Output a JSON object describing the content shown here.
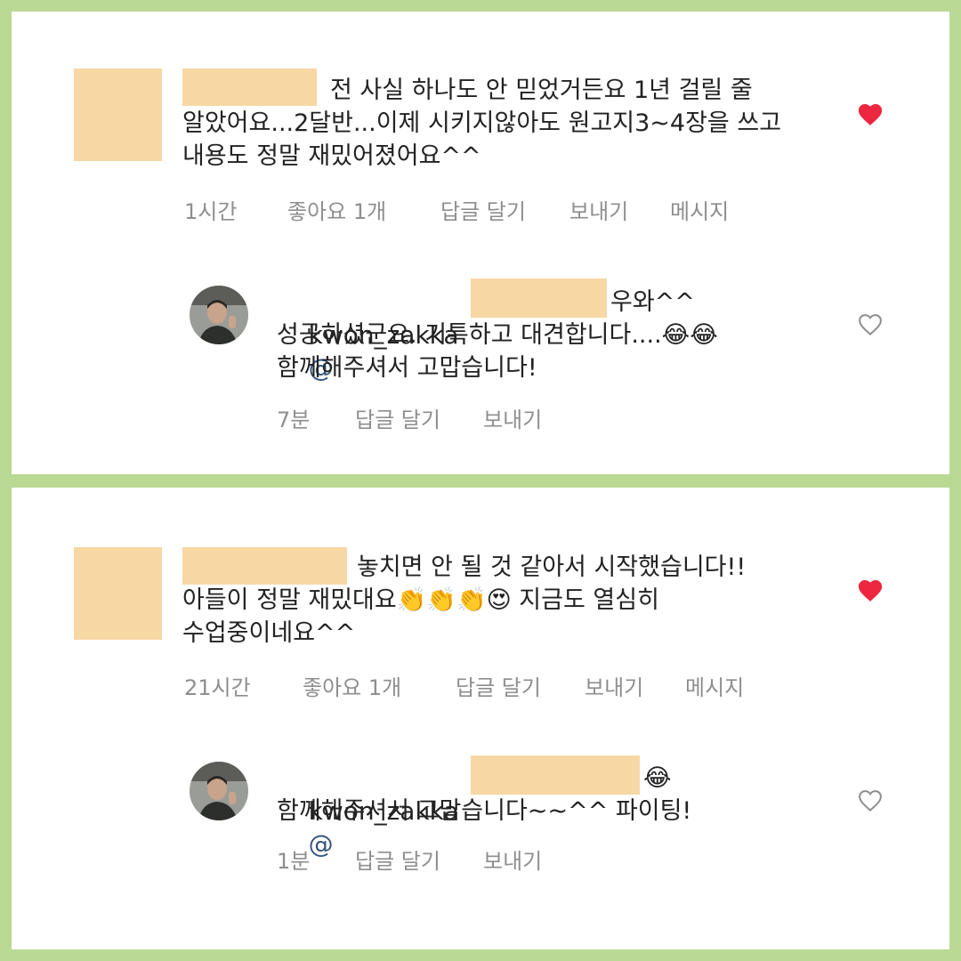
{
  "colors": {
    "background": "#bad994",
    "panel": "#ffffff",
    "redaction": "#f7d7a4",
    "text": "#222222",
    "meta_text": "#8e8e8e",
    "mention": "#34557e",
    "liked_heart": "#ed2740",
    "unliked_heart": "#8e8e8e"
  },
  "comments": [
    {
      "text": "전 사실 하나도 안 믿었거든요 1년 걸릴 줄 알았어요...2달반...이제 시키지않아도 원고지3~4장을 쓰고 내용도 정말 재밌어졌어요^^",
      "time": "1시간",
      "likes": "좋아요 1개",
      "reply_action": "답글 달기",
      "send_action": "보내기",
      "message_action": "메시지",
      "liked": true,
      "reply": {
        "username": "kwon_zakka",
        "mention_symbol": "@",
        "text": "우와^^\n성공하셨군요. 기특하고 대견합니다....😂😂\n함께해주셔서 고맙습니다!",
        "time": "7분",
        "reply_action": "답글 달기",
        "send_action": "보내기",
        "liked": false
      }
    },
    {
      "text": "놓치면 안 될 것 같아서 시작했습니다!!\n아들이 정말 재밌대요👏👏👏😍 지금도 열심히\n수업중이네요^^",
      "time": "21시간",
      "likes": "좋아요 1개",
      "reply_action": "답글 달기",
      "send_action": "보내기",
      "message_action": "메시지",
      "liked": true,
      "reply": {
        "username": "kwon_zakka",
        "mention_symbol": "@",
        "text": "😂\n함께해주셔서 고맙습니다~~^^ 파이팅!",
        "time": "1분",
        "reply_action": "답글 달기",
        "send_action": "보내기",
        "liked": false
      }
    }
  ]
}
